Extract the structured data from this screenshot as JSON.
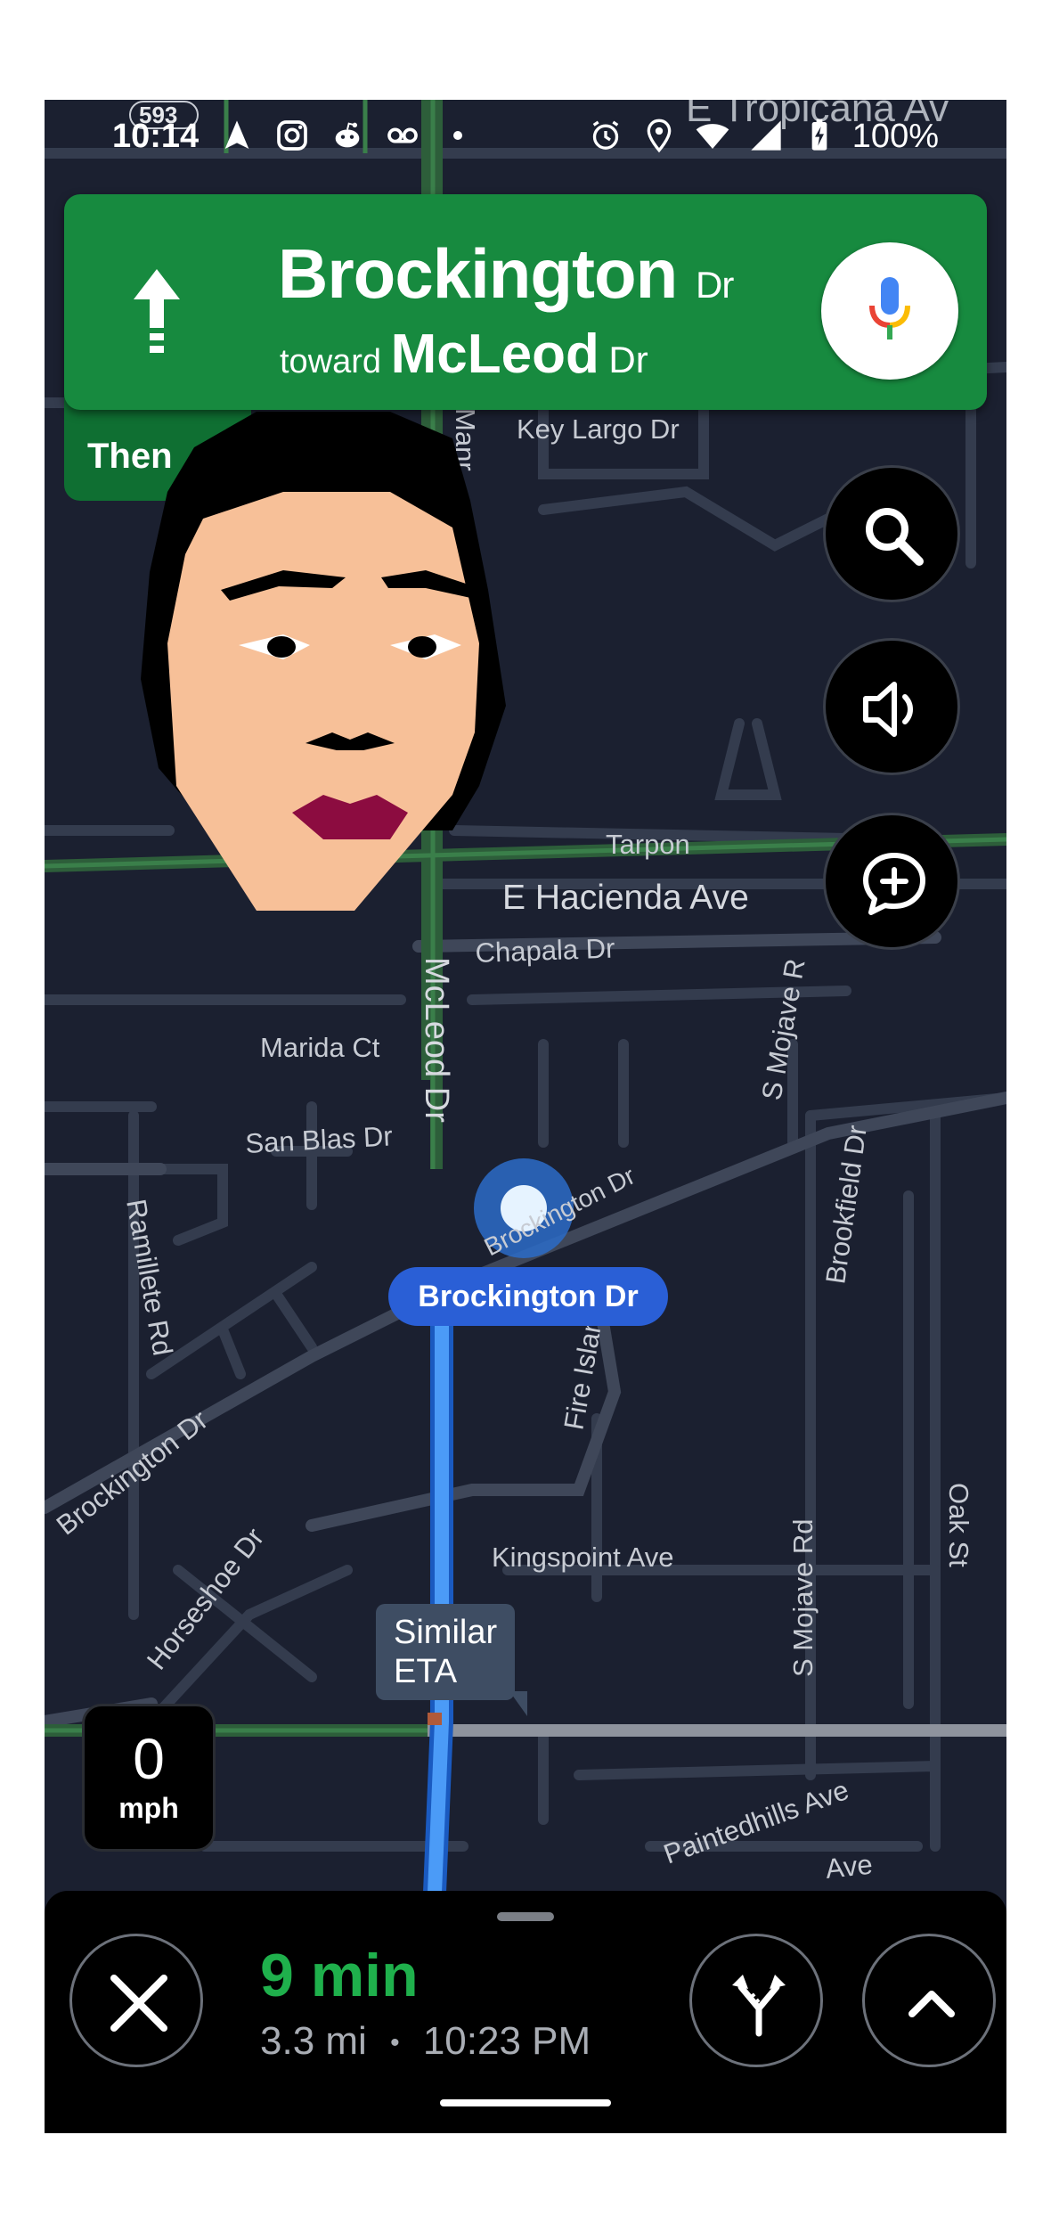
{
  "status_bar": {
    "time": "10:14",
    "battery": "100%",
    "left_icons": [
      "navigation-arrow-icon",
      "instagram-icon",
      "reddit-icon",
      "voicemail-icon",
      "notification-dot-icon"
    ],
    "right_icons": [
      "alarm-icon",
      "location-icon",
      "wifi-icon",
      "signal-icon",
      "battery-charging-icon"
    ]
  },
  "navigation": {
    "maneuver_icon": "straight-arrow-icon",
    "street_name": "Brockington",
    "street_suffix": "Dr",
    "toward_label": "toward",
    "toward_name": "McLeod",
    "toward_suffix": "Dr",
    "then_label": "Then",
    "mic_icon": "microphone-icon"
  },
  "map_controls": {
    "search_icon": "search-icon",
    "sound_icon": "volume-icon",
    "report_icon": "add-report-icon"
  },
  "map": {
    "street_labels": {
      "highway_shield": "593",
      "tropicana": "E Tropicana Av",
      "key_largo": "Key Largo Dr",
      "manr": "Manr",
      "tarpon": "Tarpon",
      "hacienda": "E Hacienda Ave",
      "chapala": "Chapala Dr",
      "mcleod": "McLeod Dr",
      "marida": "Marida Ct",
      "san_blas": "San Blas Dr",
      "s_mojave_upper": "S Mojave R",
      "brookfield": "Brookfield Dr",
      "brockington_near": "Brockington Dr",
      "ramillete": "Ramillete Rd",
      "fire_island": "Fire Island",
      "brockington_west": "Brockington Dr",
      "kingspoint": "Kingspoint Ave",
      "horseshoe": "Horseshoe Dr",
      "s_mojave_lower": "S Mojave Rd",
      "oak": "Oak St",
      "paintedhills": "Paintedhills Ave",
      "ave_fragment": "Ave"
    },
    "current_road_label": "Brockington Dr",
    "eta_bubble": [
      "Similar",
      "ETA"
    ]
  },
  "speedometer": {
    "value": "0",
    "unit": "mph"
  },
  "trip": {
    "duration": "9 min",
    "distance": "3.3 mi",
    "separator": "•",
    "arrival": "10:23 PM",
    "close_icon": "close-icon",
    "alternate_routes_icon": "alternate-routes-icon",
    "expand_icon": "chevron-up-icon"
  },
  "colors": {
    "banner_green": "#178a3f",
    "then_green": "#0f6f32",
    "route_blue": "#3b8cf0",
    "map_bg": "#1b2030",
    "eta_green": "#1fb04c"
  }
}
